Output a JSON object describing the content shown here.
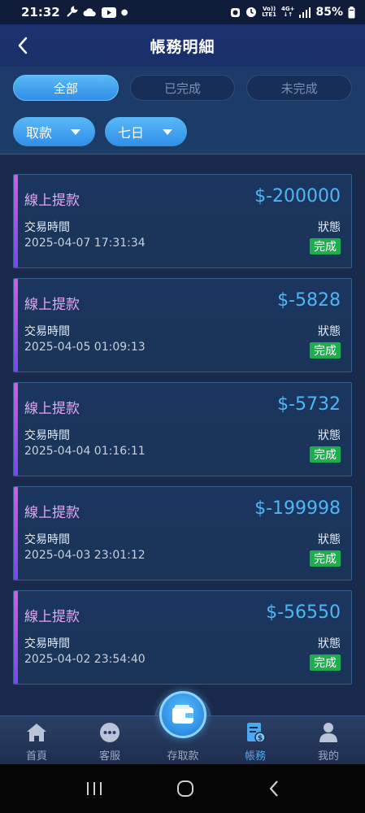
{
  "status_bar": {
    "time": "21:32",
    "battery": "85%",
    "network": "LTE1",
    "signal_4g": "4G+",
    "volte": "Vo))"
  },
  "header": {
    "title": "帳務明細"
  },
  "tabs": [
    {
      "label": "全部",
      "active": true
    },
    {
      "label": "已完成",
      "active": false
    },
    {
      "label": "未完成",
      "active": false
    }
  ],
  "filters": {
    "type": "取款",
    "period": "七日"
  },
  "records": [
    {
      "title": "線上提款",
      "amount": "$-200000",
      "time_label": "交易時間",
      "time": "2025-04-07 17:31:34",
      "status_label": "狀態",
      "status": "完成"
    },
    {
      "title": "線上提款",
      "amount": "$-5828",
      "time_label": "交易時間",
      "time": "2025-04-05 01:09:13",
      "status_label": "狀態",
      "status": "完成"
    },
    {
      "title": "線上提款",
      "amount": "$-5732",
      "time_label": "交易時間",
      "time": "2025-04-04 01:16:11",
      "status_label": "狀態",
      "status": "完成"
    },
    {
      "title": "線上提款",
      "amount": "$-199998",
      "time_label": "交易時間",
      "time": "2025-04-03 23:01:12",
      "status_label": "狀態",
      "status": "完成"
    },
    {
      "title": "線上提款",
      "amount": "$-56550",
      "time_label": "交易時間",
      "time": "2025-04-02 23:54:40",
      "status_label": "狀態",
      "status": "完成"
    }
  ],
  "bottom_nav": [
    {
      "label": "首頁",
      "icon": "home-icon",
      "active": false
    },
    {
      "label": "客服",
      "icon": "chat-icon",
      "active": false
    },
    {
      "label": "存取款",
      "icon": "wallet-icon",
      "active": false
    },
    {
      "label": "帳務",
      "icon": "ledger-icon",
      "active": true
    },
    {
      "label": "我的",
      "icon": "user-icon",
      "active": false
    }
  ],
  "colors": {
    "accent": "#4fb6f5",
    "status_done": "#1fae4f",
    "card_title": "#dfa8f5"
  }
}
